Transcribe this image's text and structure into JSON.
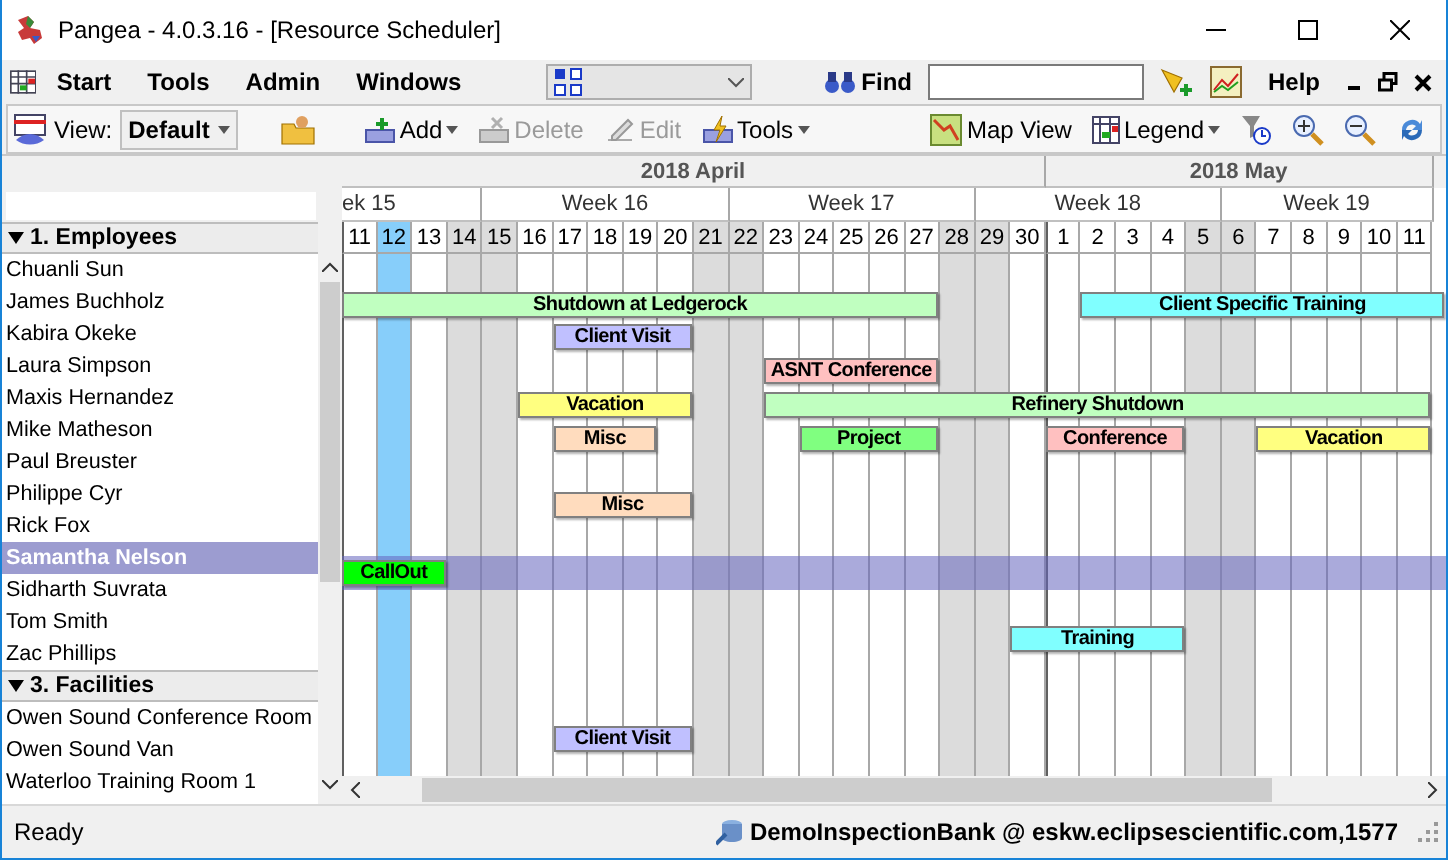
{
  "window": {
    "title": "Pangea - 4.0.3.16 - [Resource Scheduler]"
  },
  "menu": [
    "Start",
    "Tools",
    "Admin",
    "Windows"
  ],
  "find": {
    "label": "Find"
  },
  "help": "Help",
  "toolbar": {
    "view_label": "View:",
    "view_value": "Default",
    "buttons": [
      {
        "kind": "add",
        "label": "Add",
        "disabled": false,
        "dropdown": true
      },
      {
        "kind": "delete",
        "label": "Delete",
        "disabled": true,
        "dropdown": false
      },
      {
        "kind": "edit",
        "label": "Edit",
        "disabled": true,
        "dropdown": false
      },
      {
        "kind": "tools",
        "label": "Tools",
        "disabled": false,
        "dropdown": true
      }
    ],
    "right_buttons": [
      {
        "kind": "map",
        "label": "Map View",
        "dropdown": false
      },
      {
        "kind": "legend",
        "label": "Legend",
        "dropdown": true
      }
    ]
  },
  "timeline": {
    "months": [
      "2018 April",
      "2018 May"
    ],
    "weeks": [
      {
        "label": "ek 15",
        "days": [
          {
            "label": "11",
            "weekend": false,
            "today": false,
            "month_start": true
          },
          {
            "label": "12",
            "weekend": false,
            "today": true,
            "month_start": false
          },
          {
            "label": "13",
            "weekend": false,
            "today": false,
            "month_start": false
          },
          {
            "label": "14",
            "weekend": true,
            "today": false,
            "month_start": false
          }
        ]
      },
      {
        "label": "Week 16",
        "days": [
          {
            "label": "15",
            "weekend": true,
            "today": false,
            "month_start": false
          },
          {
            "label": "16",
            "weekend": false,
            "today": false,
            "month_start": false
          },
          {
            "label": "17",
            "weekend": false,
            "today": false,
            "month_start": false
          },
          {
            "label": "18",
            "weekend": false,
            "today": false,
            "month_start": false
          },
          {
            "label": "19",
            "weekend": false,
            "today": false,
            "month_start": false
          },
          {
            "label": "20",
            "weekend": false,
            "today": false,
            "month_start": false
          },
          {
            "label": "21",
            "weekend": true,
            "today": false,
            "month_start": false
          }
        ]
      },
      {
        "label": "Week 17",
        "days": [
          {
            "label": "22",
            "weekend": true,
            "today": false,
            "month_start": false
          },
          {
            "label": "23",
            "weekend": false,
            "today": false,
            "month_start": false
          },
          {
            "label": "24",
            "weekend": false,
            "today": false,
            "month_start": false
          },
          {
            "label": "25",
            "weekend": false,
            "today": false,
            "month_start": false
          },
          {
            "label": "26",
            "weekend": false,
            "today": false,
            "month_start": false
          },
          {
            "label": "27",
            "weekend": false,
            "today": false,
            "month_start": false
          },
          {
            "label": "28",
            "weekend": true,
            "today": false,
            "month_start": false
          }
        ]
      },
      {
        "label": "Week 18",
        "days": [
          {
            "label": "29",
            "weekend": true,
            "today": false,
            "month_start": false
          },
          {
            "label": "30",
            "weekend": false,
            "today": false,
            "month_start": false
          },
          {
            "label": "1",
            "weekend": false,
            "today": false,
            "month_start": true
          },
          {
            "label": "2",
            "weekend": false,
            "today": false,
            "month_start": false
          },
          {
            "label": "3",
            "weekend": false,
            "today": false,
            "month_start": false
          },
          {
            "label": "4",
            "weekend": false,
            "today": false,
            "month_start": false
          },
          {
            "label": "5",
            "weekend": true,
            "today": false,
            "month_start": false
          }
        ]
      },
      {
        "label": "Week 19",
        "days": [
          {
            "label": "6",
            "weekend": true,
            "today": false,
            "month_start": false
          },
          {
            "label": "7",
            "weekend": false,
            "today": false,
            "month_start": false
          },
          {
            "label": "8",
            "weekend": false,
            "today": false,
            "month_start": false
          },
          {
            "label": "9",
            "weekend": false,
            "today": false,
            "month_start": false
          },
          {
            "label": "10",
            "weekend": false,
            "today": false,
            "month_start": false
          },
          {
            "label": "11",
            "weekend": false,
            "today": false,
            "month_start": false
          }
        ]
      }
    ]
  },
  "groups": [
    {
      "label": "1. Employees",
      "expanded": true,
      "rows": [
        {
          "name": "Chuanli Sun",
          "selected": false
        },
        {
          "name": "James Buchholz",
          "selected": false,
          "bookings": [
            {
              "label": "Shutdown at Ledgerock",
              "color": "#c0ffc0"
            },
            {
              "label": "Client Specific Training",
              "color": "#80ffff"
            }
          ]
        },
        {
          "name": "Kabira Okeke",
          "selected": false,
          "bookings": [
            {
              "label": "Client Visit",
              "color": "#c0c0ff"
            }
          ]
        },
        {
          "name": "Laura Simpson",
          "selected": false,
          "bookings": [
            {
              "label": "ASNT Conference",
              "color": "#ffc0c0"
            }
          ]
        },
        {
          "name": "Maxis Hernandez",
          "selected": false,
          "bookings": [
            {
              "label": "Vacation",
              "color": "#ffff80"
            },
            {
              "label": "Refinery Shutdown",
              "color": "#c0ffc0"
            }
          ]
        },
        {
          "name": "Mike Matheson",
          "selected": false,
          "bookings": [
            {
              "label": "Misc",
              "color": "#ffdcbe"
            },
            {
              "label": "Project",
              "color": "#80ff80"
            },
            {
              "label": "Conference",
              "color": "#ffc0c0"
            },
            {
              "label": "Vacation",
              "color": "#ffff80"
            }
          ]
        },
        {
          "name": "Paul Breuster",
          "selected": false
        },
        {
          "name": "Philippe Cyr",
          "selected": false,
          "bookings": [
            {
              "label": "Misc",
              "color": "#ffdcbe"
            }
          ]
        },
        {
          "name": "Rick Fox",
          "selected": false
        },
        {
          "name": "Samantha Nelson",
          "selected": true,
          "bookings": [
            {
              "label": "CallOut",
              "color": "#00ff00"
            }
          ]
        },
        {
          "name": "Sidharth Suvrata",
          "selected": false
        },
        {
          "name": "Tom Smith",
          "selected": false,
          "bookings": [
            {
              "label": "Training",
              "color": "#80ffff"
            }
          ]
        },
        {
          "name": "Zac Phillips",
          "selected": false
        }
      ]
    },
    {
      "label": "3. Facilities",
      "expanded": true,
      "rows": [
        {
          "name": "Owen Sound Conference Room",
          "selected": false,
          "bookings": [
            {
              "label": "Client Visit",
              "color": "#c0c0ff"
            }
          ]
        },
        {
          "name": "Owen Sound Van",
          "selected": false
        },
        {
          "name": "Waterloo Training Room 1",
          "selected": false
        }
      ]
    }
  ],
  "status_bar": {
    "status": "Ready",
    "connection": "DemoInspectionBank @ eskw.eclipsescientific.com,1577"
  }
}
